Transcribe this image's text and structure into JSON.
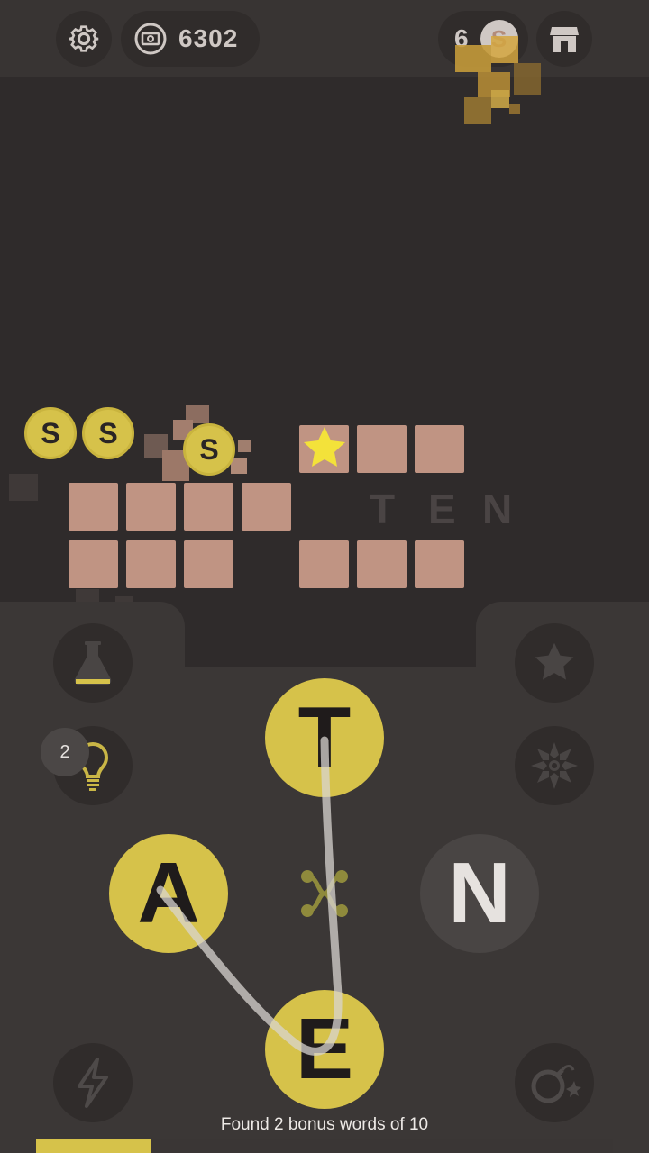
{
  "header": {
    "settings_icon": "gear-icon",
    "coins_icon": "money-icon",
    "coins": "6302",
    "gems_count": "6",
    "gem_letter": "S",
    "shop_icon": "shop-icon"
  },
  "board": {
    "coin_letter": "S",
    "bonus_word_letters": [
      "T",
      "E",
      "N"
    ]
  },
  "powerups": {
    "flask_icon": "flask-icon",
    "hint_icon": "lightbulb-icon",
    "hint_count": "2",
    "star_icon": "star-icon",
    "burst_icon": "burst-icon",
    "lightning_icon": "lightning-icon",
    "bomb_icon": "bomb-icon",
    "shuffle_icon": "shuffle-icon"
  },
  "wheel": {
    "letters": [
      "T",
      "A",
      "N",
      "E"
    ]
  },
  "footer": {
    "bonus_text": "Found 2 bonus words of 10",
    "bonus_found": 2,
    "bonus_total": 10
  },
  "colors": {
    "accent": "#d6c24a",
    "tile": "#c09483",
    "background": "#2f2b2b"
  }
}
